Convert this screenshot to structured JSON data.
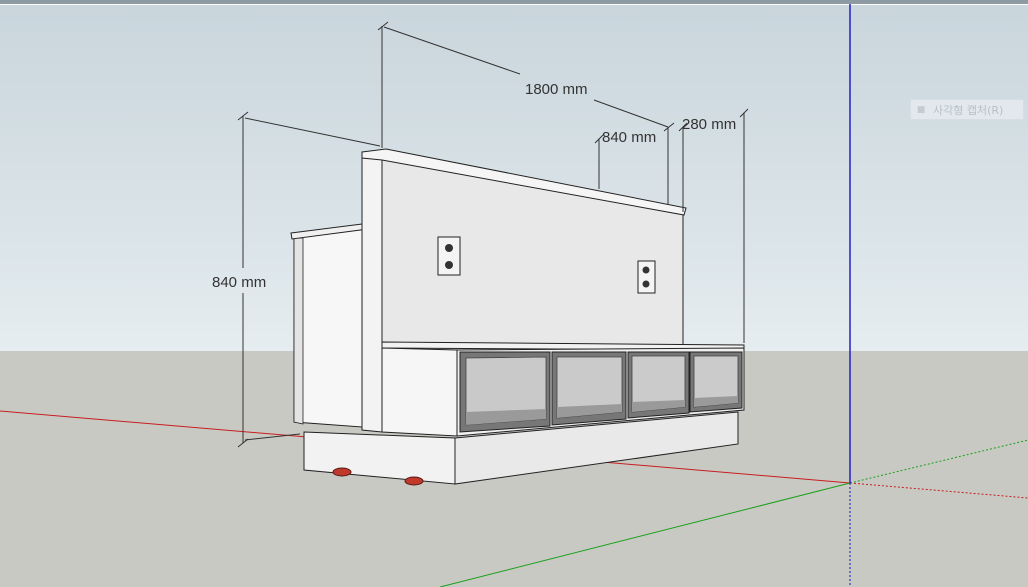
{
  "dimensions": {
    "width_total": "1800 mm",
    "width_sub": "840 mm",
    "depth": "280 mm",
    "height": "840 mm"
  },
  "capture_button": {
    "label": "사각형 캡처(R)",
    "icon": "capture-icon"
  },
  "colors": {
    "sky": "#dde6ea",
    "ground": "#c9c9c4",
    "axis_red": "#c81e1e",
    "axis_green": "#1aa01a",
    "axis_blue": "#1414c8",
    "caster_red": "#c0392b"
  }
}
